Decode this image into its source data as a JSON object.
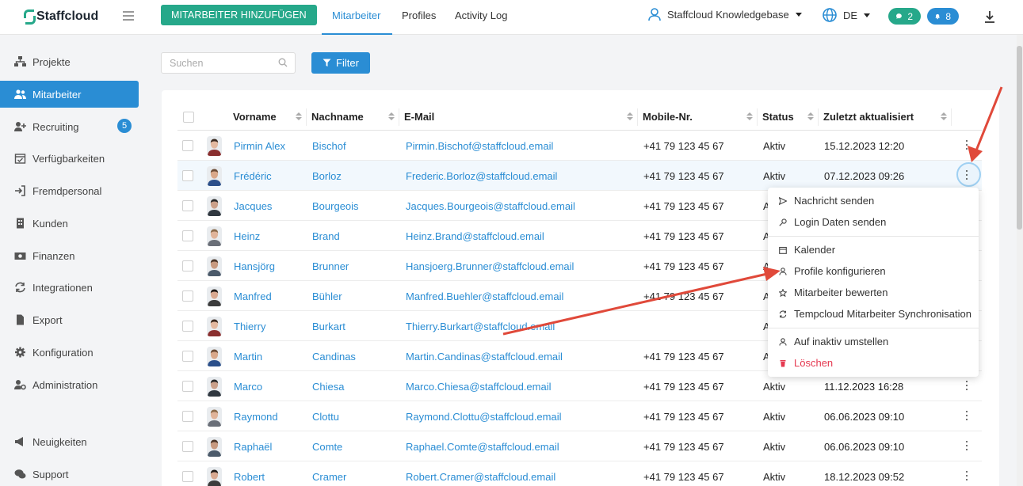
{
  "app": {
    "logo_text": "Staffcloud",
    "brand_color": "#26a88a",
    "accent_color": "#2a8dd4"
  },
  "topbar": {
    "add_button": "MITARBEITER HINZUFÜGEN",
    "tabs": [
      {
        "label": "Mitarbeiter",
        "active": true
      },
      {
        "label": "Profiles",
        "active": false
      },
      {
        "label": "Activity Log",
        "active": false
      }
    ],
    "tenant": "Staffcloud Knowledgebase",
    "language": "DE",
    "messages_count": "2",
    "notifications_count": "8"
  },
  "sidebar": {
    "items": [
      {
        "label": "Projekte",
        "icon": "sitemap-icon"
      },
      {
        "label": "Mitarbeiter",
        "icon": "users-icon",
        "active": true
      },
      {
        "label": "Recruiting",
        "icon": "user-plus-icon",
        "badge": "5"
      },
      {
        "label": "Verfügbarkeiten",
        "icon": "calendar-check-icon"
      },
      {
        "label": "Fremdpersonal",
        "icon": "sign-in-icon"
      },
      {
        "label": "Kunden",
        "icon": "building-icon"
      },
      {
        "label": "Finanzen",
        "icon": "money-icon"
      },
      {
        "label": "Integrationen",
        "icon": "sync-icon"
      },
      {
        "label": "Export",
        "icon": "file-icon"
      },
      {
        "label": "Konfiguration",
        "icon": "gear-icon"
      },
      {
        "label": "Administration",
        "icon": "user-cog-icon"
      }
    ],
    "bottom_items": [
      {
        "label": "Neuigkeiten",
        "icon": "megaphone-icon"
      },
      {
        "label": "Support",
        "icon": "chat-icon"
      }
    ]
  },
  "toolbar": {
    "search_placeholder": "Suchen",
    "filter_label": "Filter"
  },
  "table": {
    "headers": [
      "Vorname",
      "Nachname",
      "E-Mail",
      "Mobile-Nr.",
      "Status",
      "Zuletzt aktualisiert"
    ],
    "rows": [
      {
        "first": "Pirmin Alex",
        "last": "Bischof",
        "email": "Pirmin.Bischof@staffcloud.email",
        "mobile": "+41 79 123 45 67",
        "status": "Aktiv",
        "updated": "15.12.2023 12:20"
      },
      {
        "first": "Frédéric",
        "last": "Borloz",
        "email": "Frederic.Borloz@staffcloud.email",
        "mobile": "+41 79 123 45 67",
        "status": "Aktiv",
        "updated": "07.12.2023 09:26"
      },
      {
        "first": "Jacques",
        "last": "Bourgeois",
        "email": "Jacques.Bourgeois@staffcloud.email",
        "mobile": "+41 79 123 45 67",
        "status": "A",
        "updated": ""
      },
      {
        "first": "Heinz",
        "last": "Brand",
        "email": "Heinz.Brand@staffcloud.email",
        "mobile": "+41 79 123 45 67",
        "status": "A",
        "updated": ""
      },
      {
        "first": "Hansjörg",
        "last": "Brunner",
        "email": "Hansjoerg.Brunner@staffcloud.email",
        "mobile": "+41 79 123 45 67",
        "status": "A",
        "updated": ""
      },
      {
        "first": "Manfred",
        "last": "Bühler",
        "email": "Manfred.Buehler@staffcloud.email",
        "mobile": "+41 79 123 45 67",
        "status": "A",
        "updated": ""
      },
      {
        "first": "Thierry",
        "last": "Burkart",
        "email": "Thierry.Burkart@staffcloud.email",
        "mobile": "",
        "status": "A",
        "updated": ""
      },
      {
        "first": "Martin",
        "last": "Candinas",
        "email": "Martin.Candinas@staffcloud.email",
        "mobile": "+41 79 123 45 67",
        "status": "A",
        "updated": ""
      },
      {
        "first": "Marco",
        "last": "Chiesa",
        "email": "Marco.Chiesa@staffcloud.email",
        "mobile": "+41 79 123 45 67",
        "status": "Aktiv",
        "updated": "11.12.2023 16:28"
      },
      {
        "first": "Raymond",
        "last": "Clottu",
        "email": "Raymond.Clottu@staffcloud.email",
        "mobile": "+41 79 123 45 67",
        "status": "Aktiv",
        "updated": "06.06.2023 09:10"
      },
      {
        "first": "Raphaël",
        "last": "Comte",
        "email": "Raphael.Comte@staffcloud.email",
        "mobile": "+41 79 123 45 67",
        "status": "Aktiv",
        "updated": "06.06.2023 09:10"
      },
      {
        "first": "Robert",
        "last": "Cramer",
        "email": "Robert.Cramer@staffcloud.email",
        "mobile": "+41 79 123 45 67",
        "status": "Aktiv",
        "updated": "18.12.2023 09:52"
      }
    ]
  },
  "context_menu": {
    "items": [
      {
        "label": "Nachricht senden",
        "icon": "send-icon"
      },
      {
        "label": "Login Daten senden",
        "icon": "key-icon"
      },
      {
        "label": "Kalender",
        "icon": "calendar-icon"
      },
      {
        "label": "Profile konfigurieren",
        "icon": "user-icon"
      },
      {
        "label": "Mitarbeiter bewerten",
        "icon": "star-icon"
      },
      {
        "label": "Tempcloud Mitarbeiter Synchronisation",
        "icon": "sync-icon"
      },
      {
        "label": "Auf inaktiv umstellen",
        "icon": "user-icon"
      },
      {
        "label": "Löschen",
        "icon": "trash-icon",
        "danger": true
      }
    ]
  },
  "annotation_color": "#e0493a"
}
